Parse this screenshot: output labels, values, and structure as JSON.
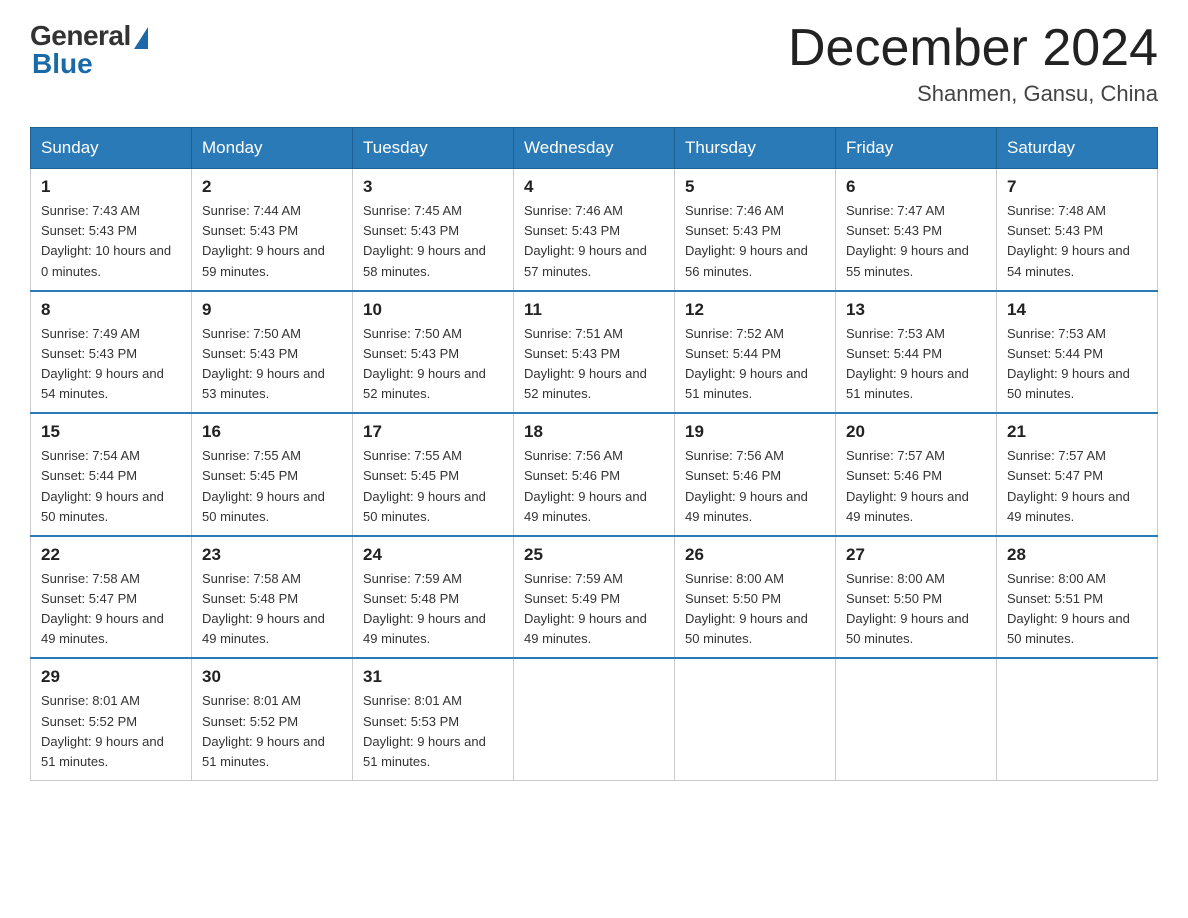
{
  "header": {
    "logo_general": "General",
    "logo_blue": "Blue",
    "month_title": "December 2024",
    "location": "Shanmen, Gansu, China"
  },
  "weekdays": [
    "Sunday",
    "Monday",
    "Tuesday",
    "Wednesday",
    "Thursday",
    "Friday",
    "Saturday"
  ],
  "weeks": [
    [
      {
        "day": "1",
        "sunrise": "7:43 AM",
        "sunset": "5:43 PM",
        "daylight": "10 hours and 0 minutes"
      },
      {
        "day": "2",
        "sunrise": "7:44 AM",
        "sunset": "5:43 PM",
        "daylight": "9 hours and 59 minutes"
      },
      {
        "day": "3",
        "sunrise": "7:45 AM",
        "sunset": "5:43 PM",
        "daylight": "9 hours and 58 minutes"
      },
      {
        "day": "4",
        "sunrise": "7:46 AM",
        "sunset": "5:43 PM",
        "daylight": "9 hours and 57 minutes"
      },
      {
        "day": "5",
        "sunrise": "7:46 AM",
        "sunset": "5:43 PM",
        "daylight": "9 hours and 56 minutes"
      },
      {
        "day": "6",
        "sunrise": "7:47 AM",
        "sunset": "5:43 PM",
        "daylight": "9 hours and 55 minutes"
      },
      {
        "day": "7",
        "sunrise": "7:48 AM",
        "sunset": "5:43 PM",
        "daylight": "9 hours and 54 minutes"
      }
    ],
    [
      {
        "day": "8",
        "sunrise": "7:49 AM",
        "sunset": "5:43 PM",
        "daylight": "9 hours and 54 minutes"
      },
      {
        "day": "9",
        "sunrise": "7:50 AM",
        "sunset": "5:43 PM",
        "daylight": "9 hours and 53 minutes"
      },
      {
        "day": "10",
        "sunrise": "7:50 AM",
        "sunset": "5:43 PM",
        "daylight": "9 hours and 52 minutes"
      },
      {
        "day": "11",
        "sunrise": "7:51 AM",
        "sunset": "5:43 PM",
        "daylight": "9 hours and 52 minutes"
      },
      {
        "day": "12",
        "sunrise": "7:52 AM",
        "sunset": "5:44 PM",
        "daylight": "9 hours and 51 minutes"
      },
      {
        "day": "13",
        "sunrise": "7:53 AM",
        "sunset": "5:44 PM",
        "daylight": "9 hours and 51 minutes"
      },
      {
        "day": "14",
        "sunrise": "7:53 AM",
        "sunset": "5:44 PM",
        "daylight": "9 hours and 50 minutes"
      }
    ],
    [
      {
        "day": "15",
        "sunrise": "7:54 AM",
        "sunset": "5:44 PM",
        "daylight": "9 hours and 50 minutes"
      },
      {
        "day": "16",
        "sunrise": "7:55 AM",
        "sunset": "5:45 PM",
        "daylight": "9 hours and 50 minutes"
      },
      {
        "day": "17",
        "sunrise": "7:55 AM",
        "sunset": "5:45 PM",
        "daylight": "9 hours and 50 minutes"
      },
      {
        "day": "18",
        "sunrise": "7:56 AM",
        "sunset": "5:46 PM",
        "daylight": "9 hours and 49 minutes"
      },
      {
        "day": "19",
        "sunrise": "7:56 AM",
        "sunset": "5:46 PM",
        "daylight": "9 hours and 49 minutes"
      },
      {
        "day": "20",
        "sunrise": "7:57 AM",
        "sunset": "5:46 PM",
        "daylight": "9 hours and 49 minutes"
      },
      {
        "day": "21",
        "sunrise": "7:57 AM",
        "sunset": "5:47 PM",
        "daylight": "9 hours and 49 minutes"
      }
    ],
    [
      {
        "day": "22",
        "sunrise": "7:58 AM",
        "sunset": "5:47 PM",
        "daylight": "9 hours and 49 minutes"
      },
      {
        "day": "23",
        "sunrise": "7:58 AM",
        "sunset": "5:48 PM",
        "daylight": "9 hours and 49 minutes"
      },
      {
        "day": "24",
        "sunrise": "7:59 AM",
        "sunset": "5:48 PM",
        "daylight": "9 hours and 49 minutes"
      },
      {
        "day": "25",
        "sunrise": "7:59 AM",
        "sunset": "5:49 PM",
        "daylight": "9 hours and 49 minutes"
      },
      {
        "day": "26",
        "sunrise": "8:00 AM",
        "sunset": "5:50 PM",
        "daylight": "9 hours and 50 minutes"
      },
      {
        "day": "27",
        "sunrise": "8:00 AM",
        "sunset": "5:50 PM",
        "daylight": "9 hours and 50 minutes"
      },
      {
        "day": "28",
        "sunrise": "8:00 AM",
        "sunset": "5:51 PM",
        "daylight": "9 hours and 50 minutes"
      }
    ],
    [
      {
        "day": "29",
        "sunrise": "8:01 AM",
        "sunset": "5:52 PM",
        "daylight": "9 hours and 51 minutes"
      },
      {
        "day": "30",
        "sunrise": "8:01 AM",
        "sunset": "5:52 PM",
        "daylight": "9 hours and 51 minutes"
      },
      {
        "day": "31",
        "sunrise": "8:01 AM",
        "sunset": "5:53 PM",
        "daylight": "9 hours and 51 minutes"
      },
      null,
      null,
      null,
      null
    ]
  ]
}
